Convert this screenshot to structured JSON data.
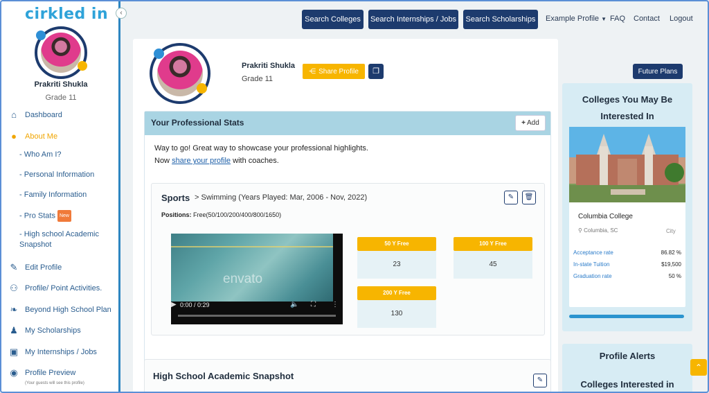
{
  "brand": {
    "logo_text": "cirkled in"
  },
  "sidebar": {
    "name": "Prakriti Shukla",
    "grade": "Grade 11",
    "items": [
      {
        "label": "Dashboard",
        "icon": "home-icon"
      },
      {
        "label": "About Me",
        "icon": "user-icon"
      },
      {
        "label": "Edit Profile",
        "icon": "edit-icon"
      },
      {
        "label": "Profile/ Point Activities.",
        "icon": "users-icon"
      },
      {
        "label": "Beyond High School Plan",
        "icon": "leaf-icon"
      },
      {
        "label": "My Scholarships",
        "icon": "person-icon"
      },
      {
        "label": "My Internships / Jobs",
        "icon": "briefcase-icon"
      },
      {
        "label": "Profile Preview",
        "icon": "eye-icon"
      }
    ],
    "sub_items": [
      "- Who Am I?",
      "- Personal Information",
      "- Family Information",
      "- Pro Stats",
      "- High school Academic Snapshot"
    ],
    "new_badge": "New",
    "preview_note": "(Your guests will see this profile)"
  },
  "topnav": {
    "search_colleges": "Search Colleges",
    "search_internships": "Search Internships / Jobs",
    "search_scholarships": "Search Scholarships",
    "example_profile": "Example Profile",
    "faq": "FAQ",
    "contact": "Contact",
    "logout": "Logout"
  },
  "profile": {
    "name": "Prakriti Shukla",
    "grade": "Grade 11",
    "share_label": "Share Profile",
    "future_plans": "Future Plans"
  },
  "stats": {
    "title": "Your Professional Stats",
    "add_label": "Add",
    "msg_line1": "Way to go! Great way to showcase your professional highlights.",
    "msg_prefix": "Now ",
    "msg_link": "share your profile",
    "msg_suffix": " with coaches.",
    "sport": {
      "title": "Sports",
      "subtitle": "> Swimming",
      "years": "(Years Played: Mar, 2006 - Nov, 2022)",
      "positions_label": "Positions:",
      "positions_value": "Free(50/100/200/400/800/1650)",
      "video": {
        "watermark": "envato",
        "time": "0:00 / 0:29"
      },
      "tiles": [
        {
          "label": "50 Y Free",
          "value": "23"
        },
        {
          "label": "100 Y Free",
          "value": "45"
        },
        {
          "label": "200 Y Free",
          "value": "130"
        }
      ]
    },
    "hs_title": "High School Academic Snapshot"
  },
  "right": {
    "colleges_title": "Colleges You May Be Interested In",
    "college": {
      "name": "Columbia College",
      "location": "Columbia, SC",
      "type": "City",
      "rows": [
        {
          "label": "Acceptance rate",
          "value": "86.82 %"
        },
        {
          "label": "In-state Tuition",
          "value": "$19,500"
        },
        {
          "label": "Graduation rate",
          "value": "50 %"
        }
      ]
    },
    "alerts_title": "Profile Alerts",
    "colleges_interested": "Colleges Interested in"
  }
}
